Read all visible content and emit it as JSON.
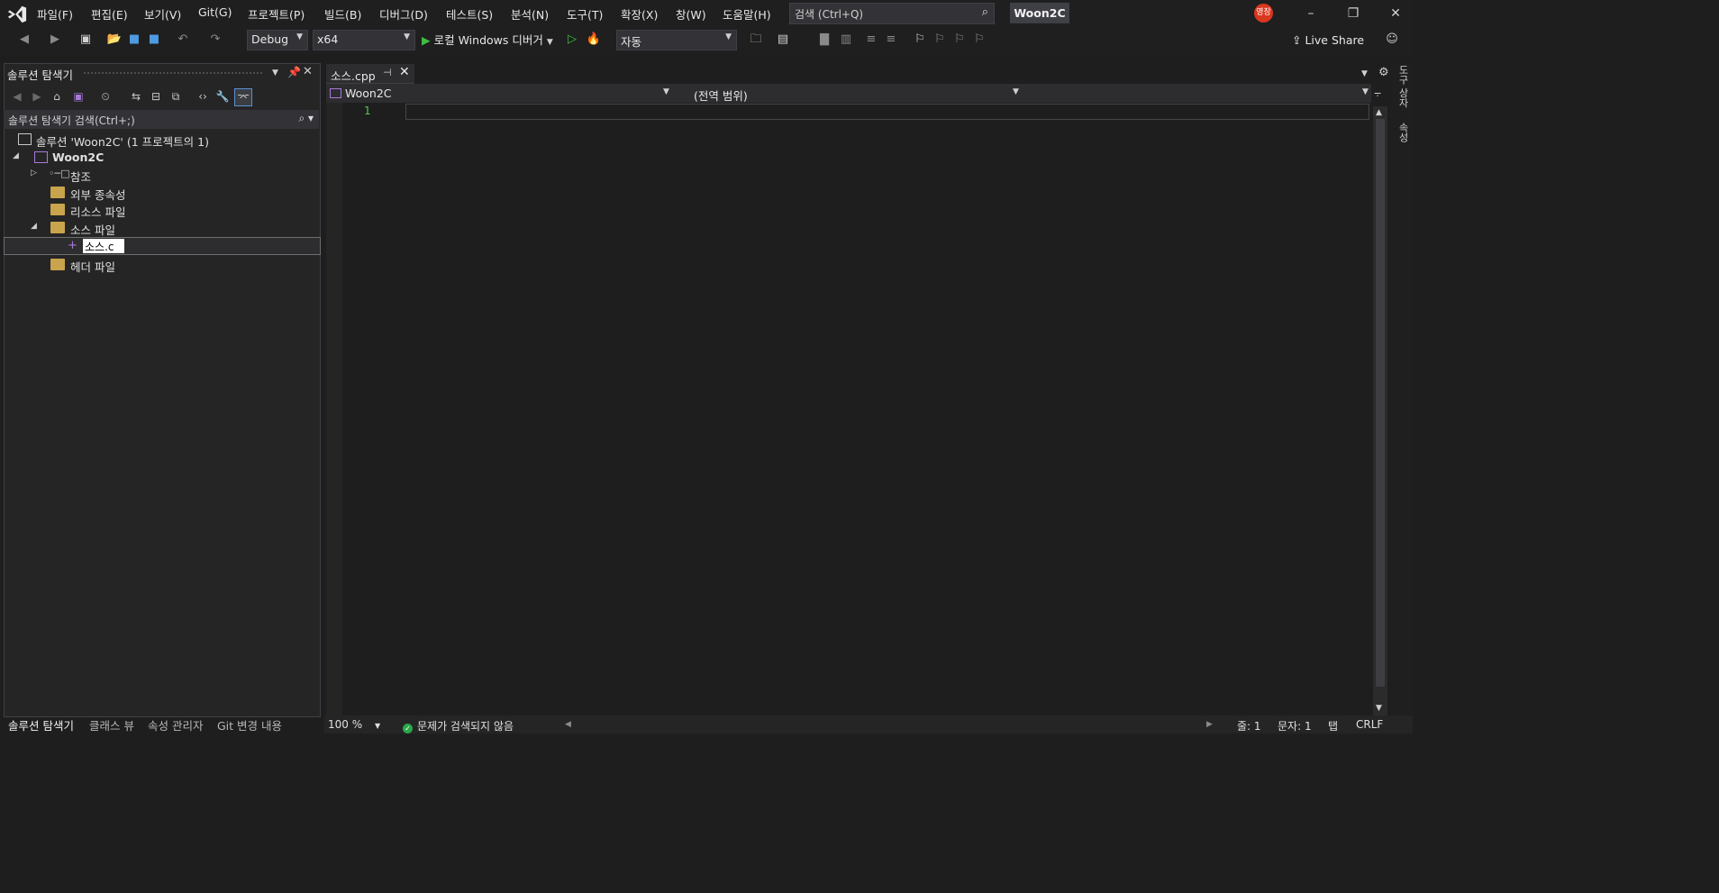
{
  "menu": {
    "items": [
      "파일(F)",
      "편집(E)",
      "보기(V)",
      "Git(G)",
      "프로젝트(P)",
      "빌드(B)",
      "디버그(D)",
      "테스트(S)",
      "분석(N)",
      "도구(T)",
      "확장(X)",
      "창(W)",
      "도움말(H)"
    ],
    "search_placeholder": "검색 (Ctrl+Q)",
    "solution_name": "Woon2C",
    "avatar_text": "영장"
  },
  "toolbar": {
    "config": "Debug",
    "platform": "x64",
    "debugger": "로컬 Windows 디버거",
    "auto": "자동",
    "live_share": "Live Share"
  },
  "solution_explorer": {
    "title": "솔루션 탐색기",
    "search_placeholder": "솔루션 탐색기 검색(Ctrl+;)",
    "solution_line": "솔루션 'Woon2C' (1 프로젝트의 1)",
    "project": "Woon2C",
    "nodes": [
      "참조",
      "외부 종속성",
      "리소스 파일",
      "소스 파일",
      "헤더 파일"
    ],
    "rename_value": "소스.c",
    "bottom_tabs": [
      "솔루션 탐색기",
      "클래스 뷰",
      "속성 관리자",
      "Git 변경 내용"
    ]
  },
  "editor": {
    "tab_label": "소스.cpp",
    "nav_project": "Woon2C",
    "nav_scope": "(전역 범위)",
    "line_number": "1"
  },
  "right_rail": [
    "도구 상자",
    "속성"
  ],
  "statusbar": {
    "zoom": "100 %",
    "issues": "문제가 검색되지 않음",
    "line": "줄: 1",
    "char": "문자: 1",
    "tab": "탭",
    "eol": "CRLF"
  },
  "colors": {
    "accent": "#3fbf3f",
    "avatar": "#d9371e",
    "background": "#1e1e1e"
  }
}
